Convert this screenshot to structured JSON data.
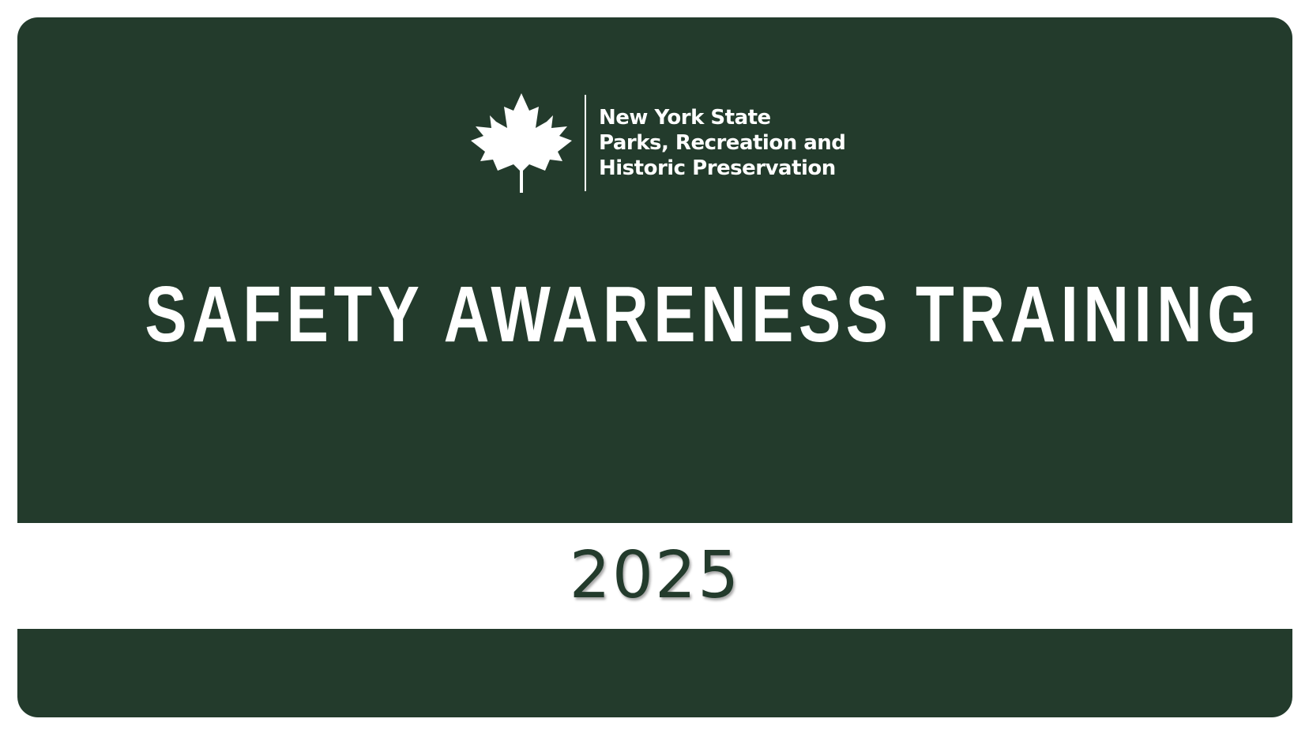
{
  "logo": {
    "icon": "maple-leaf-icon",
    "agency_lines": [
      "New York State",
      "Parks, Recreation and",
      "Historic Preservation"
    ]
  },
  "title": "SAFETY AWARENESS TRAINING",
  "year": "2025",
  "colors": {
    "primary_green": "#233b2c",
    "text_light": "#ffffff",
    "background": "#ffffff"
  }
}
